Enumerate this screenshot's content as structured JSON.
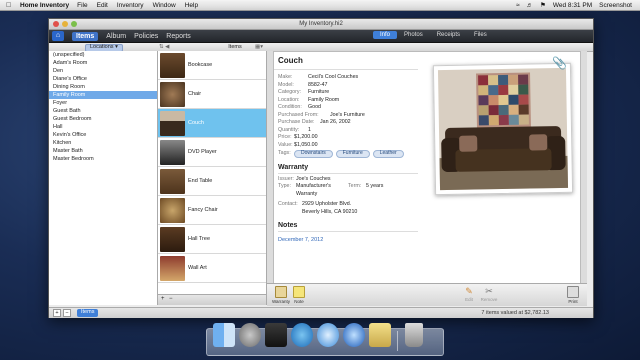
{
  "menubar": {
    "app_name": "Home Inventory",
    "menus": [
      "File",
      "Edit",
      "Inventory",
      "Window",
      "Help"
    ],
    "clock": "Wed 8:31 PM",
    "user": "Screenshot"
  },
  "window": {
    "title": "My Inventory.hi2",
    "nav_tabs": [
      "Items",
      "Album",
      "Policies",
      "Reports"
    ],
    "detail_tabs": [
      "Info",
      "Photos",
      "Receipts",
      "Files"
    ]
  },
  "locations": {
    "header": "Locations",
    "items": [
      "(unspecified)",
      "Adam's Room",
      "Den",
      "Diane's Office",
      "Dining Room",
      "Family Room",
      "Foyer",
      "Guest Bath",
      "Guest Bedroom",
      "Hall",
      "Kevin's Office",
      "Kitchen",
      "Master Bath",
      "Master Bedroom"
    ],
    "selected_index": 5
  },
  "items_list": {
    "header": "Items",
    "items": [
      "Bookcase",
      "Chair",
      "Couch",
      "DVD Player",
      "End Table",
      "Fancy Chair",
      "Hall Tree",
      "Wall Art"
    ],
    "selected_index": 2
  },
  "detail": {
    "name": "Couch",
    "fields": [
      {
        "k": "Make:",
        "v": "Cecil's Cool Couches"
      },
      {
        "k": "Model:",
        "v": "8582-47"
      },
      {
        "k": "Category:",
        "v": "Furniture"
      },
      {
        "k": "Location:",
        "v": "Family Room"
      },
      {
        "k": "Condition:",
        "v": "Good"
      },
      {
        "k": "Purchased From:",
        "v": "Joe's Furniture"
      },
      {
        "k": "Purchase Date:",
        "v": "Jan 26, 2002"
      },
      {
        "k": "Quantity:",
        "v": "1"
      },
      {
        "k": "Price:",
        "v": "$1,200.00"
      },
      {
        "k": "Value:",
        "v": "$1,050.00"
      }
    ],
    "tags_label": "Tags:",
    "tags": [
      "Downstairs",
      "Furniture",
      "Leather"
    ],
    "warranty": {
      "title": "Warranty",
      "issuer_label": "Issuer:",
      "issuer": "Joe's Couches",
      "type_label": "Type:",
      "type_line1": "Manufacturer's",
      "type_line2": "Warranty",
      "term_label": "Term:",
      "term": "5 years",
      "contact_label": "Contact:",
      "contact_line1": "2929 Upholster Blvd.",
      "contact_line2": "Beverly Hills, CA 90210"
    },
    "notes": {
      "title": "Notes",
      "date": "December 7, 2012"
    }
  },
  "actions": {
    "warranty": "Warranty",
    "note": "Note",
    "edit": "Edit",
    "remove": "Remove",
    "print": "Print"
  },
  "bottom": {
    "items_button": "Items",
    "total": "7 items valued at $2,782.13"
  },
  "colors": {
    "accent": "#3f7fd8",
    "selected_row": "#6fc2ee"
  }
}
